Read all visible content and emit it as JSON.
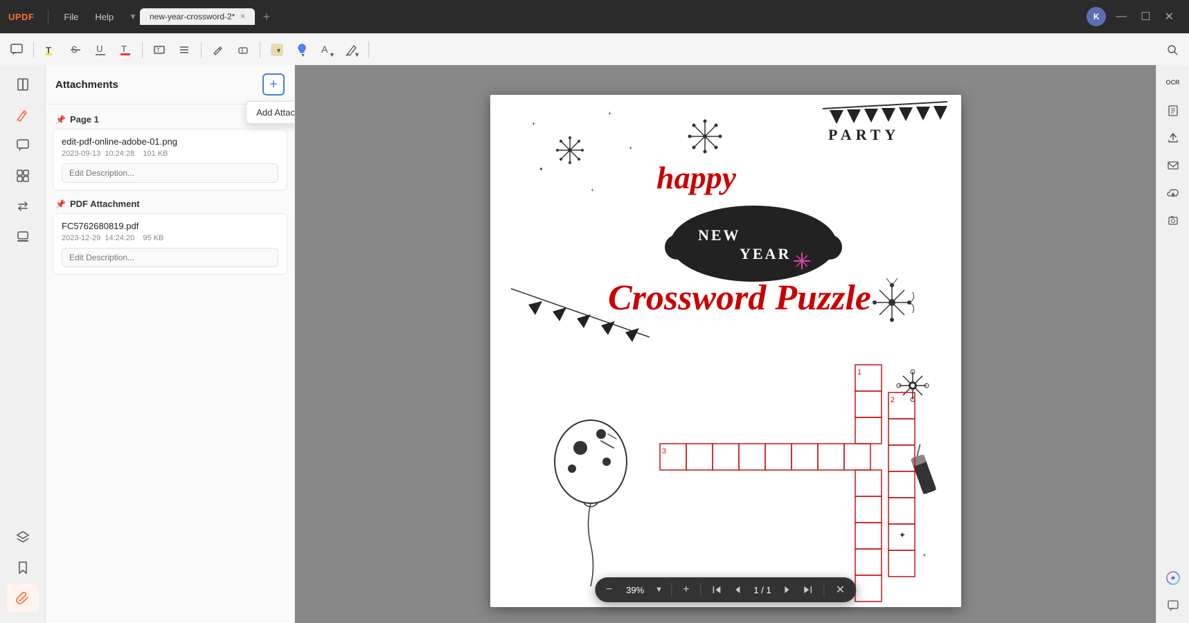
{
  "app": {
    "logo": "UPDF",
    "title_bar": {
      "menu": [
        "File",
        "Help"
      ],
      "tab_label": "new-year-crossword-2*",
      "tab_close": "×",
      "tab_add": "+",
      "avatar_letter": "K",
      "minimize": "—",
      "maximize": "☐",
      "close": "✕"
    }
  },
  "toolbar": {
    "comment_icon": "💬",
    "highlight_icon": "T",
    "strikethrough_icon": "S",
    "underline_icon": "U",
    "text_color_icon": "T",
    "text_box_icon": "T",
    "list_icon": "≡",
    "draw_icon": "✏",
    "eraser_icon": "◻",
    "color_fill": "#ffcc00",
    "pen_icon": "🖊",
    "add_text_icon": "A",
    "search_icon": "🔍"
  },
  "left_sidebar": {
    "icons": [
      {
        "name": "reader-icon",
        "symbol": "📖"
      },
      {
        "name": "edit-icon",
        "symbol": "✏",
        "active": true
      },
      {
        "name": "comment-icon",
        "symbol": "💬"
      },
      {
        "name": "organize-icon",
        "symbol": "⊞"
      },
      {
        "name": "convert-icon",
        "symbol": "⇄"
      },
      {
        "name": "stamp-icon",
        "symbol": "🏷"
      }
    ],
    "bottom_icons": [
      {
        "name": "layers-icon",
        "symbol": "◧"
      },
      {
        "name": "bookmark-icon",
        "symbol": "🔖"
      },
      {
        "name": "paperclip-icon",
        "symbol": "📎",
        "active": true
      }
    ]
  },
  "attachments_panel": {
    "title": "Attachments",
    "add_button_label": "+",
    "tooltip": "Add Attachment...",
    "groups": [
      {
        "label": "Page 1",
        "attachments": [
          {
            "filename": "edit-pdf-online-adobe-01.png",
            "meta": "2023-09-13  10:24:28    101 KB",
            "desc_placeholder": "Edit Description..."
          }
        ]
      },
      {
        "label": "PDF Attachment",
        "attachments": [
          {
            "filename": "FC5762680819.pdf",
            "meta": "2023-12-29  14:24:20    95 KB",
            "desc_placeholder": "Edit Description..."
          }
        ]
      }
    ]
  },
  "pdf_viewer": {
    "page_title": "happy NEW YEAR Crossword Puzzle",
    "zoom_minus": "−",
    "zoom_value": "39%",
    "zoom_dropdown": "▼",
    "zoom_plus": "+",
    "nav_first": "⇈",
    "nav_prev": "↑",
    "page_current": "1",
    "page_sep": "/",
    "page_total": "1",
    "nav_next": "↓",
    "nav_last": "⇊",
    "close_zoom": "✕"
  },
  "right_sidebar": {
    "icons": [
      {
        "name": "ocr-icon",
        "symbol": "OCR"
      },
      {
        "name": "import-icon",
        "symbol": "⬇"
      },
      {
        "name": "export-icon",
        "symbol": "⬆"
      },
      {
        "name": "share-icon",
        "symbol": "✉"
      },
      {
        "name": "upload-icon",
        "symbol": "☁"
      },
      {
        "name": "screenshot-icon",
        "symbol": "📷"
      },
      {
        "name": "ai-icon",
        "symbol": "✦"
      },
      {
        "name": "chat-icon",
        "symbol": "💬"
      }
    ]
  }
}
